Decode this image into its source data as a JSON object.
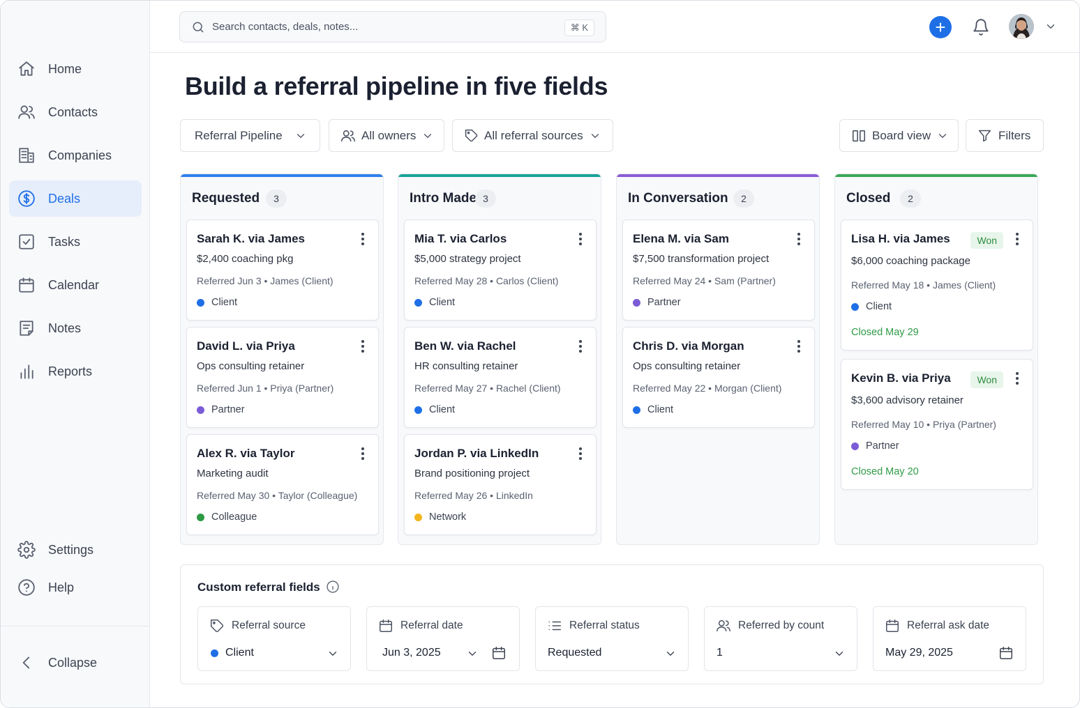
{
  "topbar": {
    "search_placeholder": "Search contacts, deals, notes...",
    "search_shortcut": "⌘ K",
    "add_icon": "plus-icon",
    "notification_icon": "bell-icon",
    "accent_color": "#1e6fe6"
  },
  "sidebar": {
    "items": [
      {
        "label": "Home",
        "icon": "home-icon",
        "active": false
      },
      {
        "label": "Contacts",
        "icon": "users-icon",
        "active": false
      },
      {
        "label": "Companies",
        "icon": "building-icon",
        "active": false
      },
      {
        "label": "Deals",
        "icon": "dollar-circle-icon",
        "active": true
      },
      {
        "label": "Tasks",
        "icon": "checkbox-icon",
        "active": false
      },
      {
        "label": "Calendar",
        "icon": "calendar-icon",
        "active": false
      },
      {
        "label": "Notes",
        "icon": "note-icon",
        "active": false
      },
      {
        "label": "Reports",
        "icon": "bar-chart-icon",
        "active": false
      }
    ],
    "settings_label": "Settings",
    "help_label": "Help",
    "collapse_label": "Collapse"
  },
  "page": {
    "title": "Build a referral pipeline in five fields"
  },
  "filters": {
    "pipeline": "Referral Pipeline",
    "owners": "All owners",
    "sources": "All referral sources",
    "view": "Board view",
    "filters": "Filters"
  },
  "columns": [
    {
      "title": "Requested",
      "count": "3",
      "color": "#2f80ed",
      "cards": [
        {
          "name": "Sarah K. via James",
          "desc": "$2,400 coaching pkg",
          "meta": "Referred Jun 3 • James (Client)",
          "tag": "Client",
          "tag_color": "#1e6fe6"
        },
        {
          "name": "David L. via Priya",
          "desc": "Ops consulting retainer",
          "meta": "Referred Jun 1 • Priya (Partner)",
          "tag": "Partner",
          "tag_color": "#7b5cd6"
        },
        {
          "name": "Alex R. via Taylor",
          "desc": "Marketing audit",
          "meta": "Referred May 30 • Taylor (Colleague)",
          "tag": "Colleague",
          "tag_color": "#2e9a45"
        }
      ]
    },
    {
      "title": "Intro Made",
      "count": "3",
      "color": "#1aa39a",
      "cards": [
        {
          "name": "Mia T. via Carlos",
          "desc": "$5,000 strategy project",
          "meta": "Referred May 28 • Carlos (Client)",
          "tag": "Client",
          "tag_color": "#1e6fe6"
        },
        {
          "name": "Ben W. via Rachel",
          "desc": "HR consulting retainer",
          "meta": "Referred May 27 • Rachel (Client)",
          "tag": "Client",
          "tag_color": "#1e6fe6"
        },
        {
          "name": "Jordan P. via LinkedIn",
          "desc": "Brand positioning project",
          "meta": "Referred May 26 • LinkedIn",
          "tag": "Network",
          "tag_color": "#f2b51d"
        }
      ]
    },
    {
      "title": "In Conversation",
      "count": "2",
      "color": "#8a5cd6",
      "cards": [
        {
          "name": "Elena M. via Sam",
          "desc": "$7,500 transformation project",
          "meta": "Referred May 24 • Sam (Partner)",
          "tag": "Partner",
          "tag_color": "#7b5cd6"
        },
        {
          "name": "Chris D. via Morgan",
          "desc": "Ops consulting retainer",
          "meta": "Referred May 22 • Morgan (Client)",
          "tag": "Client",
          "tag_color": "#1e6fe6"
        }
      ]
    },
    {
      "title": "Closed",
      "count": "2",
      "color": "#3aa855",
      "cards": [
        {
          "name": "Lisa H. via James",
          "badge": "Won",
          "desc": "$6,000 coaching package",
          "meta": "Referred May 18 • James (Client)",
          "tag": "Client",
          "tag_color": "#1e6fe6",
          "closed": "Closed May 29"
        },
        {
          "name": "Kevin B. via Priya",
          "badge": "Won",
          "desc": "$3,600 advisory retainer",
          "meta": "Referred May 10 • Priya (Partner)",
          "tag": "Partner",
          "tag_color": "#7b5cd6",
          "closed": "Closed May 20"
        }
      ]
    }
  ],
  "custom_fields": {
    "title": "Custom referral fields",
    "fields": [
      {
        "label": "Referral source",
        "value": "Client",
        "icon": "tag-icon",
        "dot_color": "#1e6fe6"
      },
      {
        "label": "Referral date",
        "value": "Jun 3, 2025",
        "icon": "calendar-icon"
      },
      {
        "label": "Referral status",
        "value": "Requested",
        "icon": "list-icon"
      },
      {
        "label": "Referred by count",
        "value": "1",
        "icon": "users-icon"
      },
      {
        "label": "Referral ask date",
        "value": "May 29, 2025",
        "icon": "calendar-icon"
      }
    ]
  }
}
